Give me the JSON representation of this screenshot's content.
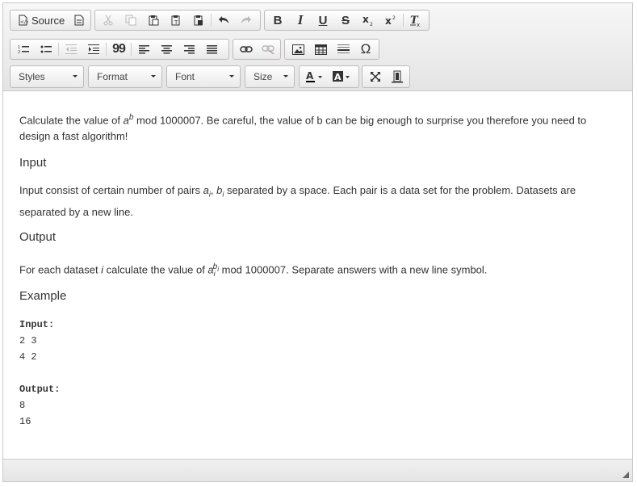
{
  "toolbar": {
    "source_label": "Source",
    "styles_label": "Styles",
    "format_label": "Format",
    "font_label": "Font",
    "size_label": "Size",
    "bold_glyph": "B",
    "italic_glyph": "I",
    "underline_glyph": "U",
    "strike_glyph": "S",
    "blockquote_glyph": "99",
    "special_char_glyph": "Ω"
  },
  "content": {
    "intro_pre": "Calculate the value of ",
    "intro_base": "a",
    "intro_exp": "b",
    "intro_post": " mod 1000007. Be careful, the value of b can be big enough to surprise you therefore you need to design a fast algorithm!",
    "input_heading": "Input",
    "input_text_pre": "Input consist of certain number of pairs ",
    "input_var_a": "a",
    "input_var_sub_i": "i",
    "input_comma": ", ",
    "input_var_b": "b",
    "input_var_sub_i2": "i",
    "input_text_post": " separated by a space. Each pair is a data set for the problem. Datasets are separated by a new line.",
    "output_heading": "Output",
    "output_text_pre": "For each dataset ",
    "output_var_i": "i",
    "output_text_mid": " calculate the value of ",
    "output_base": "a",
    "output_base_sub": "i",
    "output_exp": "b",
    "output_exp_sub": "i",
    "output_text_post": " mod 1000007. Separate answers with a new line symbol.",
    "example_heading": "Example",
    "example_input_label": "Input:",
    "example_input_lines": [
      "2 3",
      "4 2"
    ],
    "example_output_label": "Output:",
    "example_output_lines": [
      "8",
      "16"
    ]
  }
}
